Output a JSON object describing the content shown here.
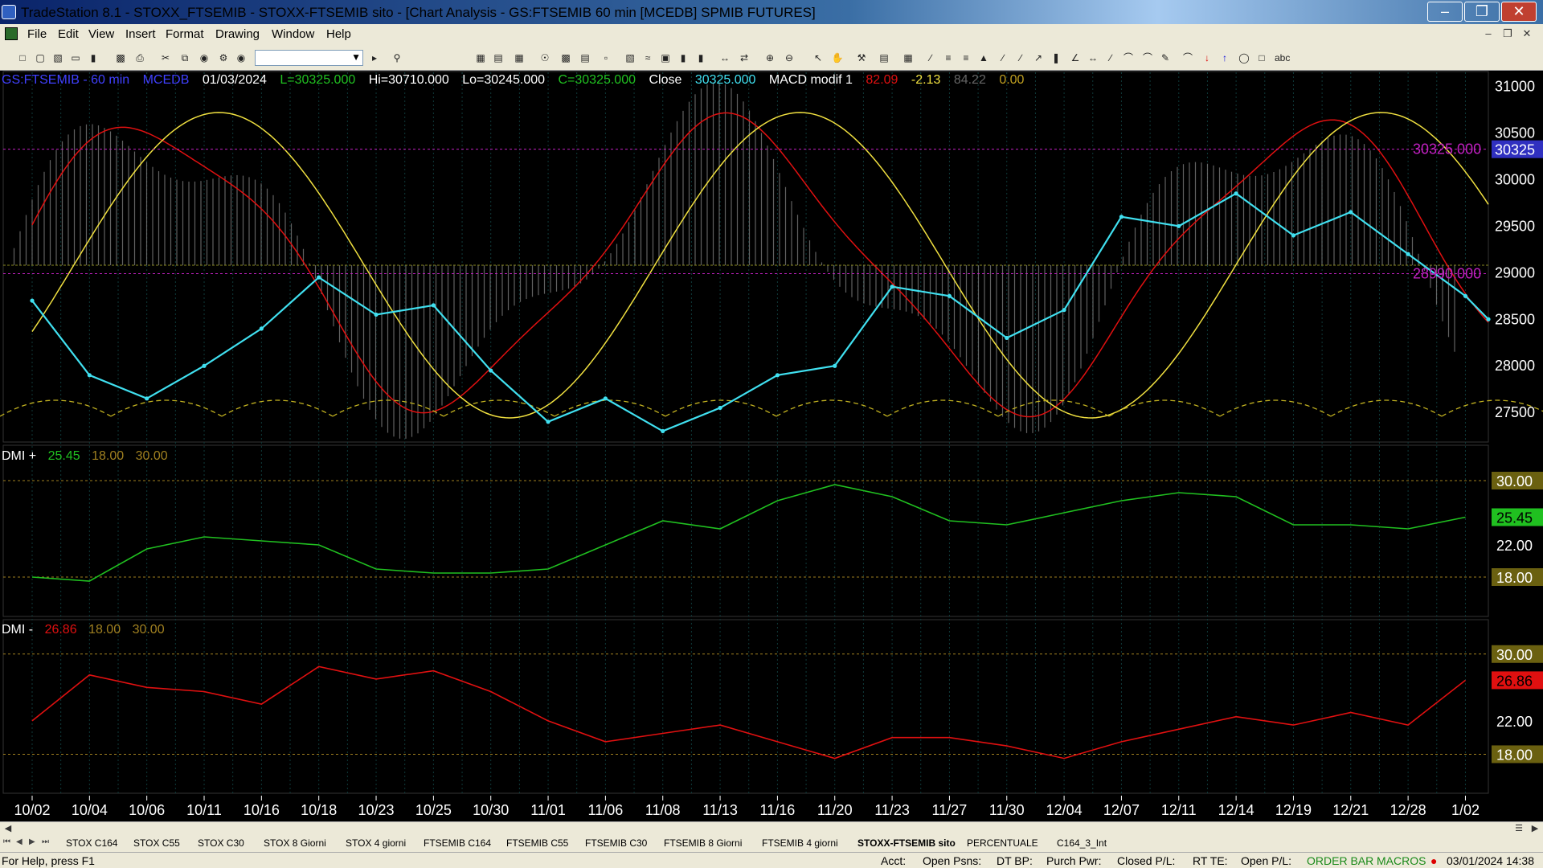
{
  "window": {
    "title": "TradeStation 8.1 - STOXX_FTSEMIB - STOXX-FTSEMIB sito - [Chart Analysis - GS:FTSEMIB  60 min  [MCEDB] SPMIB FUTURES]",
    "minimize": "‒",
    "restore": "❐",
    "close": "✕"
  },
  "menu": {
    "items": [
      "File",
      "Edit",
      "View",
      "Insert",
      "Format",
      "Drawing",
      "Window",
      "Help"
    ]
  },
  "toolbar": {
    "symbol_value": ""
  },
  "header": {
    "symbol": "GS:FTSEMIB - 60 min",
    "source": "MCEDB",
    "date": "01/03/2024",
    "low_label": "L=30325.000",
    "high_label": "Hi=30710.000",
    "lo_label": "Lo=30245.000",
    "close_label": "C=30325.000",
    "close_word": "Close",
    "close_value": "30325.000",
    "macd_name": "MACD modif 1",
    "macd_v1": "82.09",
    "macd_v2": "-2.13",
    "macd_v3": "84.22",
    "macd_v4": "0.00"
  },
  "dmi_plus": {
    "label": "DMI +",
    "value": "25.45",
    "low": "18.00",
    "high": "30.00"
  },
  "dmi_minus": {
    "label": "DMI -",
    "value": "26.86",
    "low": "18.00",
    "high": "30.00"
  },
  "colors": {
    "price": "#40e0f0",
    "macd_red": "#e01010",
    "signal_yellow": "#f0e040",
    "histogram": "#7a7a7a",
    "dmi_plus": "#20c020",
    "dmi_minus": "#e01010",
    "price_axis_text": "#ffffff",
    "level_magenta": "#c020c0"
  },
  "chart_data": [
    {
      "type": "line",
      "title": "GS:FTSEMIB - 60 min",
      "x_tick_labels": [
        "10/02",
        "10/04",
        "10/06",
        "10/11",
        "10/16",
        "10/18",
        "10/23",
        "10/25",
        "10/30",
        "11/01",
        "11/06",
        "11/08",
        "11/13",
        "11/16",
        "11/20",
        "11/23",
        "11/27",
        "11/30",
        "12/04",
        "12/07",
        "12/11",
        "12/14",
        "12/19",
        "12/21",
        "12/28",
        "1/02"
      ],
      "y_tick_labels": [
        "31000",
        "30500",
        "30000",
        "29500",
        "29000",
        "28500",
        "28000",
        "27500"
      ],
      "ylim": [
        27200,
        31150
      ],
      "levels": [
        {
          "label": "30325.000",
          "value": 30325
        },
        {
          "label": "28990.000",
          "value": 28990
        }
      ],
      "last_price_label": "30325",
      "series": [
        {
          "name": "Close",
          "x": [
            0,
            1,
            2,
            3,
            4,
            5,
            6,
            7,
            8,
            9,
            10,
            11,
            12,
            13,
            14,
            15,
            16,
            17,
            18,
            19,
            20,
            21,
            22,
            23,
            24,
            25,
            25.4
          ],
          "values": [
            28700,
            27900,
            27650,
            28000,
            28400,
            28950,
            28550,
            28650,
            27950,
            27400,
            27650,
            27300,
            27550,
            27900,
            28000,
            28850,
            28750,
            28300,
            28600,
            29600,
            29500,
            29850,
            29400,
            29650,
            29200,
            28750,
            28500
          ]
        }
      ]
    },
    {
      "type": "line",
      "title": "DMI +",
      "y_tick_labels": [
        "30.00",
        "25.45",
        "22.00",
        "18.00"
      ],
      "ylim": [
        14,
        32
      ],
      "series": [
        {
          "name": "DMI +",
          "x": [
            0,
            1,
            2,
            3,
            4,
            5,
            6,
            7,
            8,
            9,
            10,
            11,
            12,
            13,
            14,
            15,
            16,
            17,
            18,
            19,
            20,
            21,
            22,
            23,
            24,
            25
          ],
          "values": [
            18.0,
            17.5,
            21.5,
            23.0,
            22.5,
            22.0,
            19.0,
            18.5,
            18.5,
            19.0,
            22.0,
            25.0,
            24.0,
            27.5,
            29.5,
            28.0,
            25.0,
            24.5,
            26.0,
            27.5,
            28.5,
            28.0,
            24.5,
            24.5,
            24.0,
            25.45
          ]
        }
      ]
    },
    {
      "type": "line",
      "title": "DMI -",
      "y_tick_labels": [
        "30.00",
        "26.86",
        "22.00",
        "18.00"
      ],
      "ylim": [
        14,
        32
      ],
      "series": [
        {
          "name": "DMI -",
          "x": [
            0,
            1,
            2,
            3,
            4,
            5,
            6,
            7,
            8,
            9,
            10,
            11,
            12,
            13,
            14,
            15,
            16,
            17,
            18,
            19,
            20,
            21,
            22,
            23,
            24,
            25
          ],
          "values": [
            22.0,
            27.5,
            26.0,
            25.5,
            24.0,
            28.5,
            27.0,
            28.0,
            25.5,
            22.0,
            19.5,
            20.5,
            21.5,
            19.5,
            17.5,
            20.0,
            20.0,
            19.0,
            17.5,
            19.5,
            21.0,
            22.5,
            21.5,
            23.0,
            21.5,
            26.86
          ]
        }
      ]
    }
  ],
  "tabs": {
    "items": [
      "STOX C164",
      "STOX C55",
      "STOX  C30",
      "STOX  8 Giorni",
      "STOX 4 giorni",
      "FTSEMIB C164",
      "FTSEMIB C55",
      "FTSEMIB C30",
      "FTSEMIB  8 Giorni",
      "FTSEMIB  4 giorni",
      "STOXX-FTSEMIB sito",
      "PERCENTUALE",
      "C164_3_Int"
    ]
  },
  "status": {
    "help": "For Help, press F1",
    "acct": "Acct:",
    "open_psns": "Open Psns:",
    "dt_bp": "DT BP:",
    "purch_pwr": "Purch Pwr:",
    "closed_pl": "Closed P/L:",
    "rt_te": "RT TE:",
    "open_pl": "Open P/L:",
    "order_bar": "ORDER BAR",
    "macros": "MACROS",
    "datetime": "03/01/2024 14:38"
  }
}
